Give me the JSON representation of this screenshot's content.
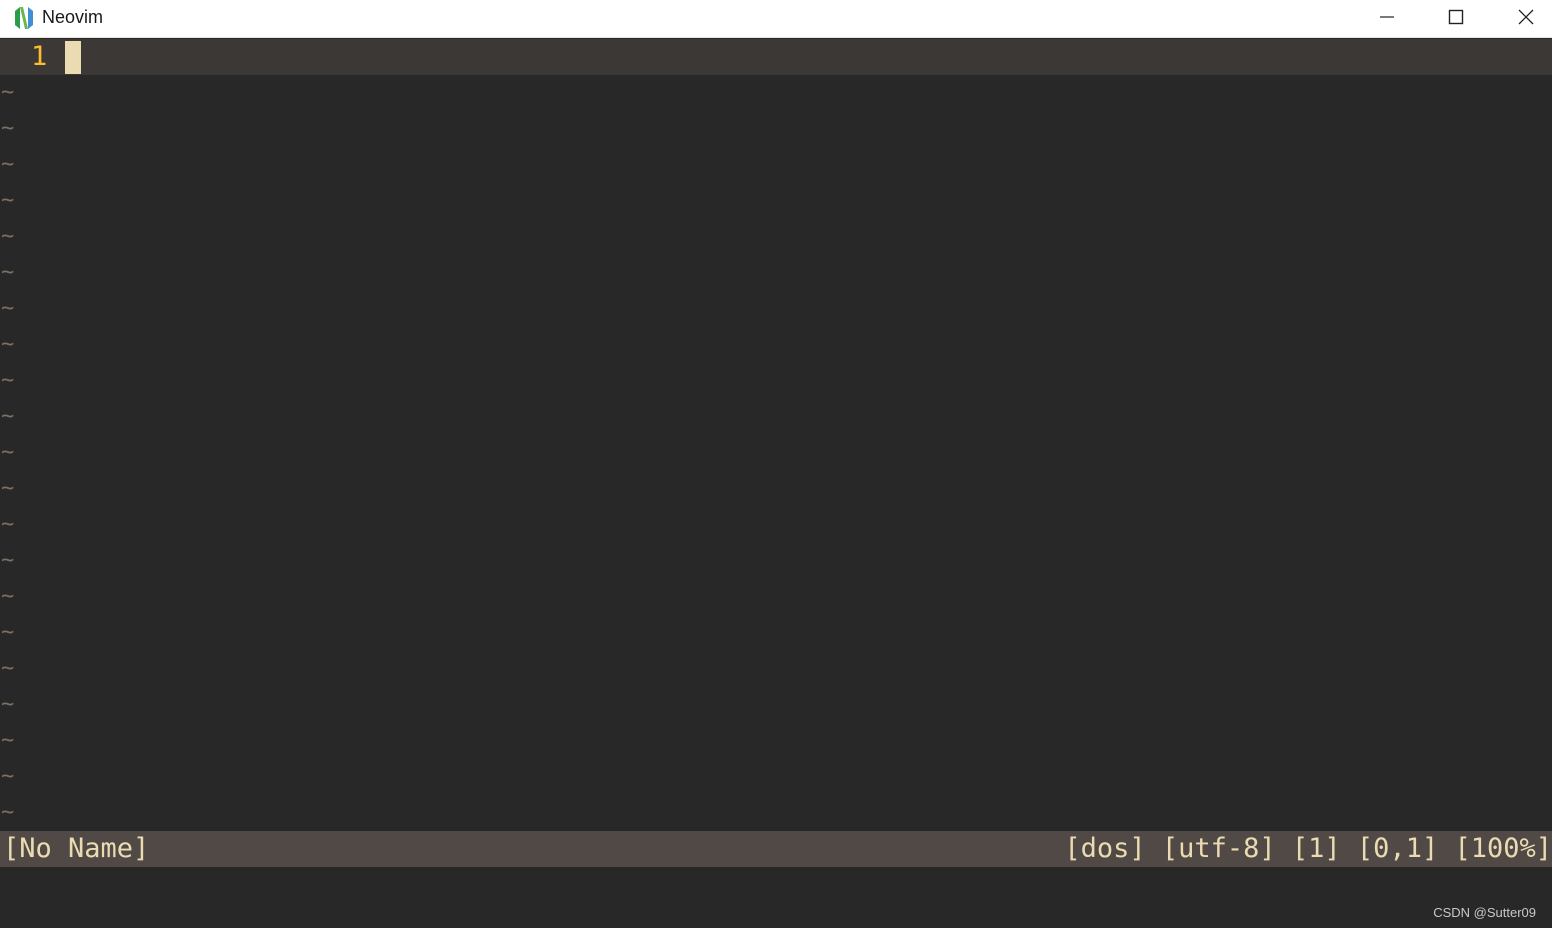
{
  "window": {
    "title": "Neovim",
    "logo_icon": "neovim-logo",
    "controls": [
      "minimize-icon",
      "maximize-icon",
      "close-icon"
    ]
  },
  "editor": {
    "current_line_number": "1",
    "empty_line_marker": "~",
    "empty_line_count": 21,
    "colors": {
      "background": "#282828",
      "cursorline": "#3c3836",
      "line_number": "#fabd2f",
      "cursor": "#ebdbb2",
      "tilde": "#7c6f64"
    }
  },
  "statusline": {
    "filename": "[No Name]",
    "info": "[dos] [utf-8] [1] [0,1] [100%]",
    "colors": {
      "background": "#504945",
      "text": "#ebdbb2"
    }
  },
  "watermark": "CSDN @Sutter09"
}
